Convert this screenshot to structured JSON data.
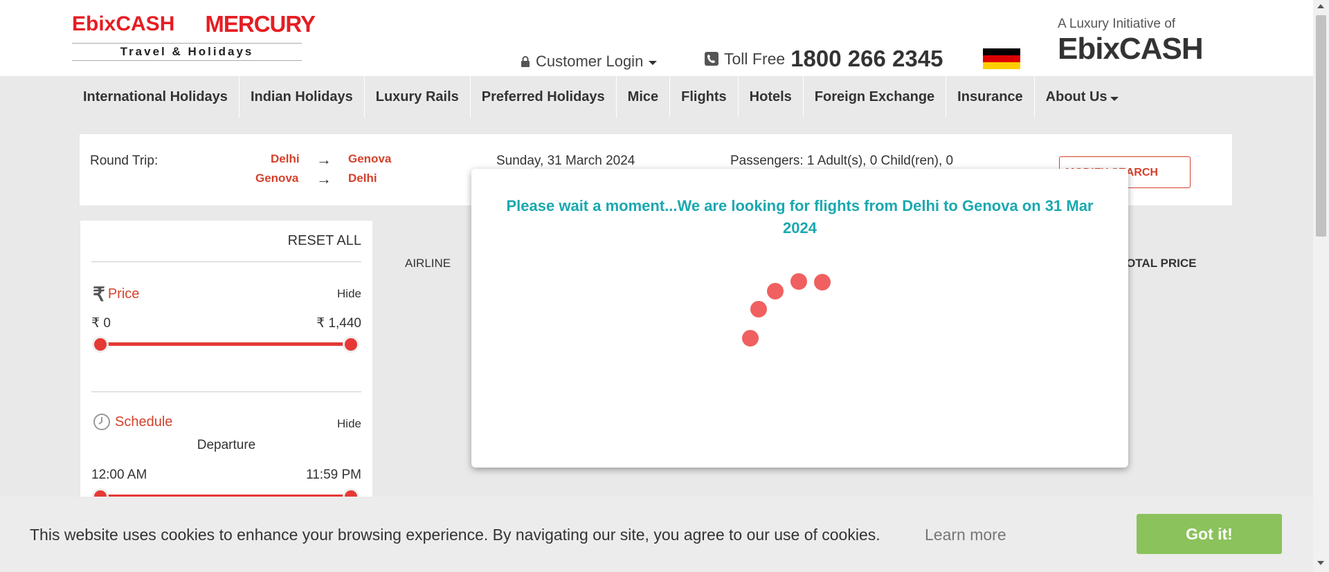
{
  "header": {
    "brand": {
      "ebix_logo": "EbixCASH",
      "mercury_logo": "MERCURY",
      "tagline": "Travel & Holidays"
    },
    "customer_login": "Customer Login",
    "toll_free_label": "Toll Free",
    "toll_free_number": "1800 266 2345",
    "luxury_text": "A Luxury Initiative of",
    "luxury_logo": "EbixCASH",
    "flag_colors": [
      "#000000",
      "#dd0000",
      "#ffce00"
    ]
  },
  "nav": {
    "items": [
      {
        "label": "International Holidays"
      },
      {
        "label": "Indian Holidays"
      },
      {
        "label": "Luxury Rails"
      },
      {
        "label": "Preferred Holidays"
      },
      {
        "label": "Mice"
      },
      {
        "label": "Flights"
      },
      {
        "label": "Hotels"
      },
      {
        "label": "Foreign Exchange"
      },
      {
        "label": "Insurance"
      },
      {
        "label": "About Us"
      }
    ]
  },
  "search": {
    "trip_type": "Round Trip:",
    "leg1_from": "Delhi",
    "leg1_to": "Genova",
    "leg2_from": "Genova",
    "leg2_to": "Delhi",
    "arrow": "→",
    "date": "Sunday, 31 March 2024",
    "passengers": "Passengers: 1 Adult(s), 0 Child(ren), 0",
    "modify_label": "MODIFY SEARCH"
  },
  "filters": {
    "reset_label": "RESET ALL",
    "price": {
      "title": "Price",
      "hide": "Hide",
      "min": "₹ 0",
      "max": "₹ 1,440",
      "range": [
        0,
        1
      ]
    },
    "schedule": {
      "title": "Schedule",
      "hide": "Hide",
      "departure": "Departure",
      "min": "12:00 AM",
      "max": "11:59 PM",
      "range": [
        0,
        1
      ]
    }
  },
  "results": {
    "col_airline": "AIRLINE",
    "col_total": "TOTAL PRICE"
  },
  "modal": {
    "message": "Please wait a moment...We are looking for flights from Delhi to Genova on 31 Mar 2024"
  },
  "cookie": {
    "message": "This website uses cookies to enhance your browsing experience. By navigating our site, you agree to our use of cookies.",
    "learn_more": "Learn more",
    "button": "Got it!"
  },
  "colors": {
    "brand_red": "#e51d23",
    "accent_red": "#d5412b",
    "teal": "#1aa8b0",
    "cookie_green": "#8bc25b"
  }
}
